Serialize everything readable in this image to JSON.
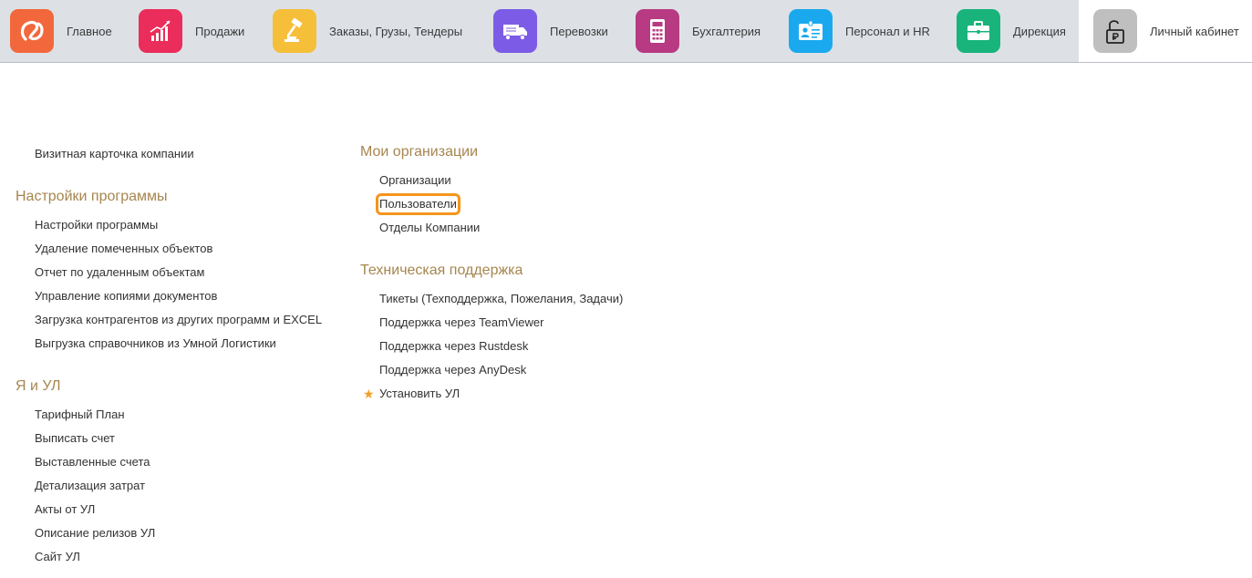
{
  "nav": {
    "sections": [
      {
        "label": "Главное",
        "icon": "logo-icon",
        "color": "#f2683c"
      },
      {
        "label": "Продажи",
        "icon": "sales-chart-icon",
        "color": "#ea2d5a"
      },
      {
        "label": "Заказы,  Грузы, Тендеры",
        "icon": "gavel-icon",
        "color": "#f6bf3a"
      },
      {
        "label": "Перевозки",
        "icon": "truck-icon",
        "color": "#7c5ce6"
      },
      {
        "label": "Бухгалтерия",
        "icon": "calculator-icon",
        "color": "#b73a82"
      },
      {
        "label": "Персонал и HR",
        "icon": "id-card-icon",
        "color": "#1aa9ee"
      },
      {
        "label": "Дирекция",
        "icon": "briefcase-icon",
        "color": "#18b47b"
      },
      {
        "label": "Личный кабинет",
        "icon": "lock-ruble-icon",
        "color": "#bfbfbf",
        "active": true
      }
    ]
  },
  "left": {
    "top_item": "Визитная карточка компании",
    "groups": [
      {
        "title": "Настройки программы",
        "items": [
          "Настройки программы",
          "Удаление помеченных объектов",
          "Отчет по удаленным объектам",
          "Управление копиями документов",
          "Загрузка контрагентов из других программ и EXCEL",
          "Выгрузка справочников из Умной Логистики"
        ]
      },
      {
        "title": "Я и УЛ",
        "items": [
          "Тарифный План",
          "Выписать счет",
          "Выставленные счета",
          "Детализация затрат",
          "Акты от УЛ",
          "Описание релизов УЛ",
          "Сайт УЛ"
        ]
      }
    ]
  },
  "right": {
    "groups": [
      {
        "title": "Мои организации",
        "items": [
          "Организации",
          "Пользователи",
          "Отделы Компании"
        ],
        "highlight_index": 1
      },
      {
        "title": "Техническая поддержка",
        "items": [
          "Тикеты (Техподдержка, Пожелания, Задачи)",
          "Поддержка через TeamViewer",
          "Поддержка через Rustdesk",
          "Поддержка через AnyDesk",
          "Установить УЛ"
        ],
        "starred_index": 4
      }
    ]
  },
  "colors": {
    "group_title": "#a6864f",
    "highlight": "#f5951d",
    "star": "#f0a028"
  }
}
